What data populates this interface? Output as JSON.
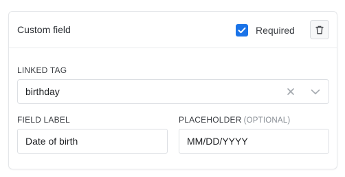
{
  "header": {
    "title": "Custom field",
    "required": {
      "label": "Required",
      "checked": true
    },
    "delete_icon": "trash-icon"
  },
  "linked_tag": {
    "label": "LINKED TAG",
    "value": "birthday",
    "clear_icon": "close-icon",
    "dropdown_icon": "chevron-down-icon"
  },
  "field_label": {
    "label": "FIELD LABEL",
    "value": "Date of birth"
  },
  "placeholder": {
    "label": "PLACEHOLDER",
    "optional_note": "(OPTIONAL)",
    "value": "MM/DD/YYYY"
  },
  "colors": {
    "accent": "#1a73e8",
    "border": "#dcdfe3",
    "muted_text": "#8a8f96"
  }
}
